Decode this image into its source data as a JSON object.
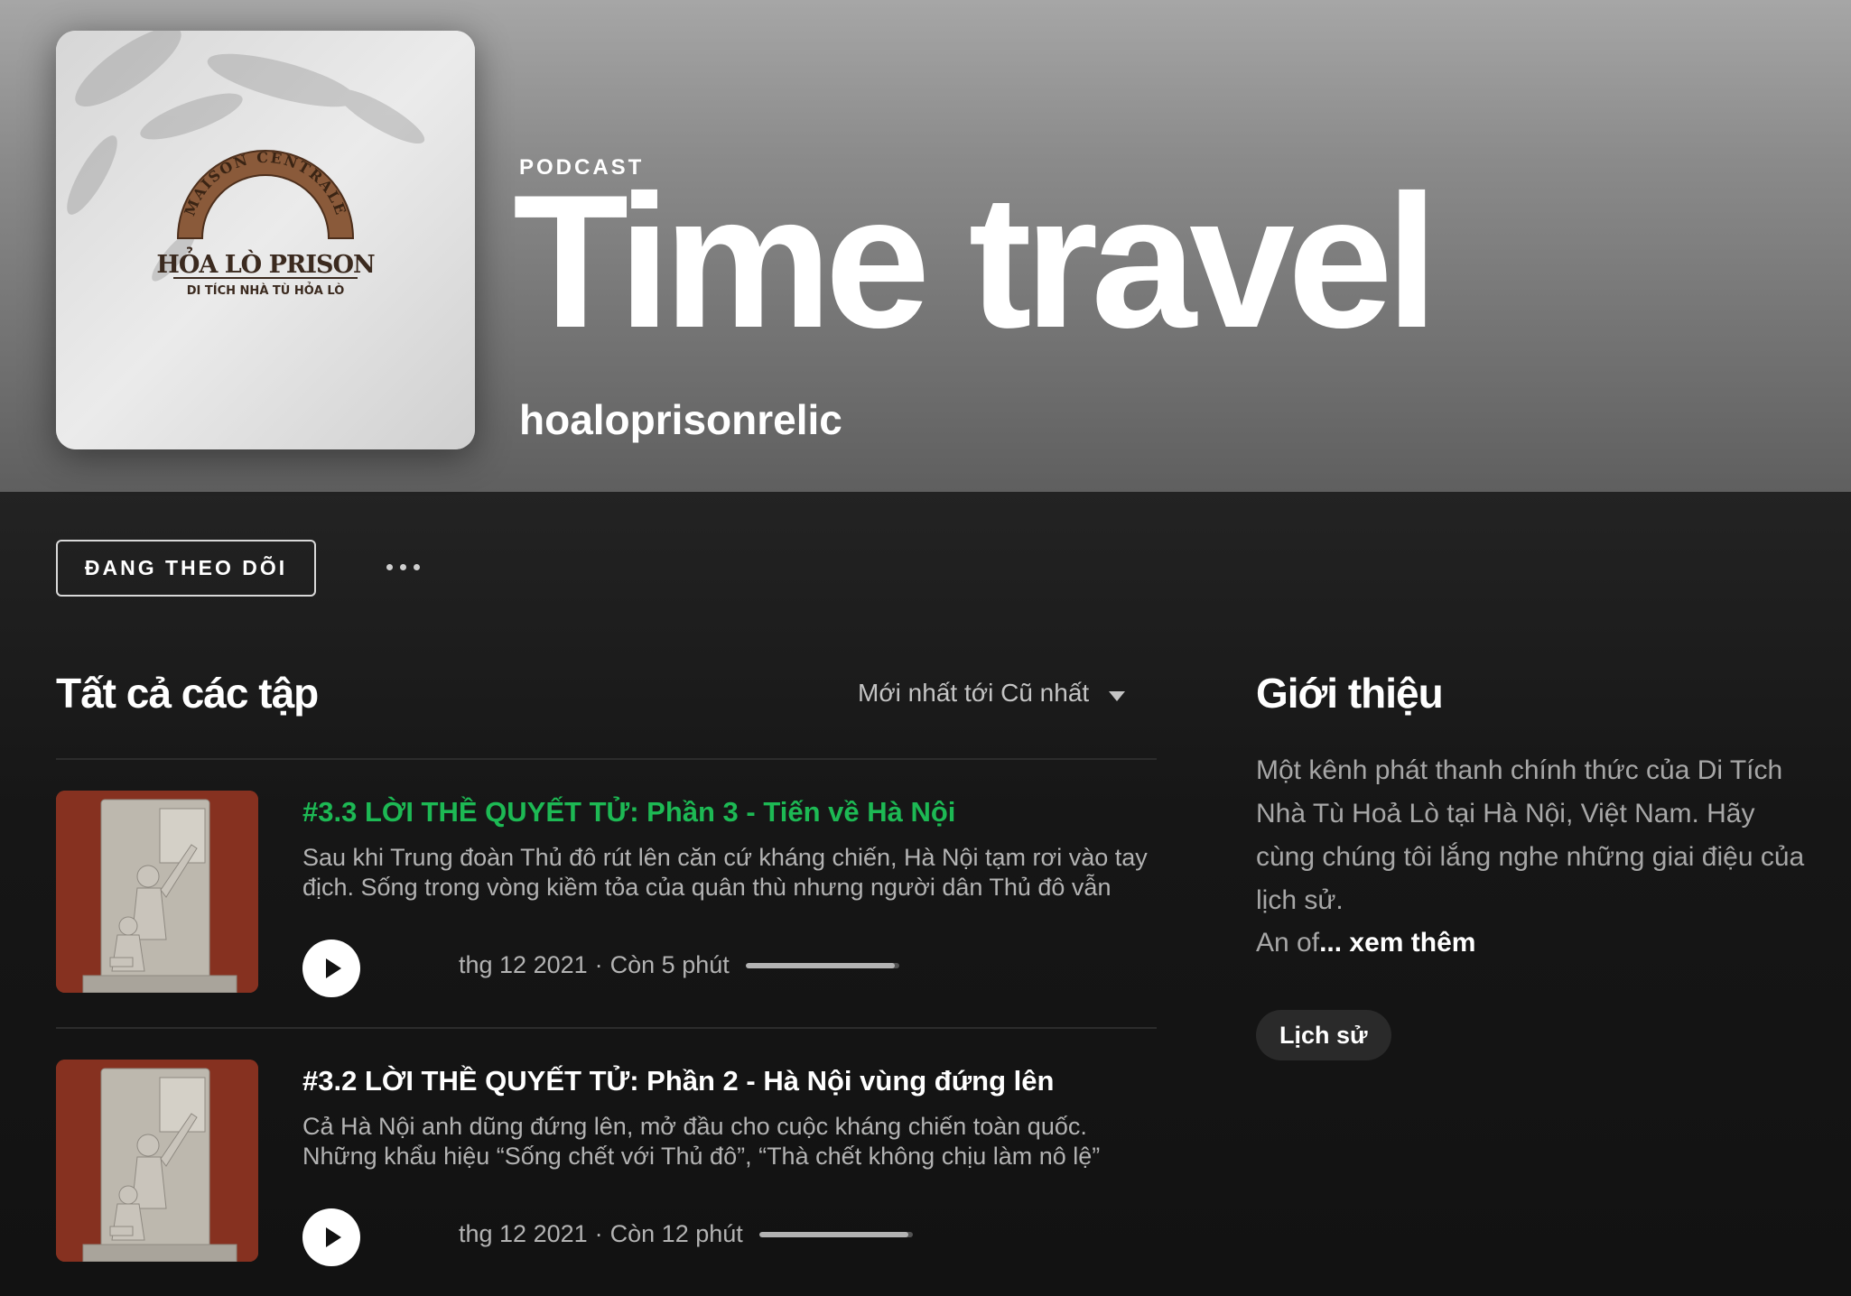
{
  "colors": {
    "accent_green": "#1db954",
    "background": "#121212",
    "hero_gray": "#8a8a8a",
    "muted_text": "#b3b3b3"
  },
  "header": {
    "type_label": "PODCAST",
    "title": "Time travel",
    "publisher": "hoaloprisonrelic",
    "cover": {
      "logo_arch_text": "MAISON CENTRALE",
      "logo_main_text": "HỎA LÒ PRISON",
      "logo_sub_text": "DI TÍCH NHÀ TÙ HỎA LÒ"
    }
  },
  "actions": {
    "follow_label": "ĐANG THEO DÕI",
    "more_icon": "more-dots-icon"
  },
  "episodes_section": {
    "title": "Tất cả các tập",
    "sort_label": "Mới nhất tới Cũ nhất",
    "sort_icon": "caret-down-icon",
    "items": [
      {
        "title": "#3.3 LỜI THỀ QUYẾT TỬ: Phần 3 - Tiến về Hà Nội",
        "title_color": "#1db954",
        "description": "Sau khi Trung đoàn Thủ đô rút lên căn cứ kháng chiến, Hà Nội tạm rơi vào tay địch. Sống trong vòng kiềm tỏa của quân thù nhưng người dân Thủ đô vẫn",
        "date": "thg 12 2021",
        "remaining": "Còn 5 phút",
        "separator": "·",
        "progress": 0.97,
        "play_icon": "play-icon"
      },
      {
        "title": "#3.2 LỜI THỀ QUYẾT TỬ: Phần 2 - Hà Nội vùng đứng lên",
        "title_color": "#ffffff",
        "description": "Cả Hà Nội anh dũng đứng lên, mở đầu cho cuộc kháng chiến toàn quốc. Những khẩu hiệu “Sống chết với Thủ đô”, “Thà chết không chịu làm nô lệ”",
        "date": "thg 12 2021",
        "remaining": "Còn 12 phút",
        "separator": "·",
        "progress": 0.97,
        "play_icon": "play-icon"
      }
    ]
  },
  "about_section": {
    "title": "Giới thiệu",
    "description": "Một kênh phát thanh chính thức của Di Tích Nhà Tù Hoả Lò tại Hà Nội, Việt Nam. Hãy cùng chúng tôi lắng nghe những giai điệu của lịch sử.",
    "truncated_start": "An of",
    "ellipsis": "...",
    "see_more_label": "xem thêm",
    "category": "Lịch sử"
  }
}
